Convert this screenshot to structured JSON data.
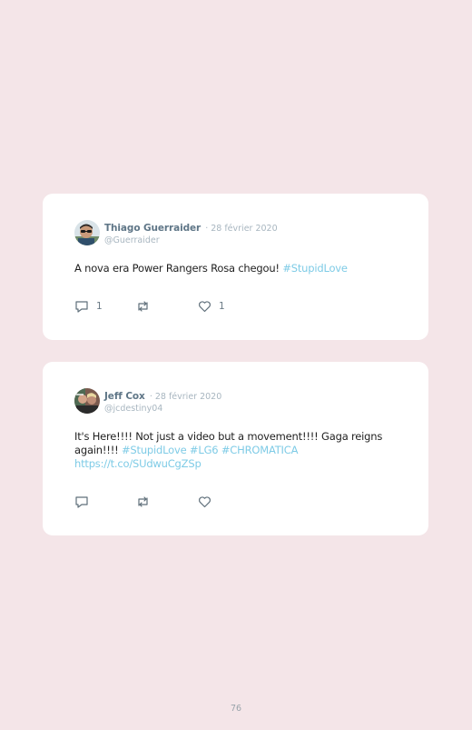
{
  "tweets": [
    {
      "name": "Thiago Guerraider",
      "date": "· 28 février 2020",
      "handle": "@Guerraider",
      "text": "A nova era Power Rangers Rosa chegou!",
      "hashtags": [
        "#StupidLove"
      ],
      "reply_count": "1",
      "retweet_count": "",
      "like_count": "1"
    },
    {
      "name": "Jeff Cox",
      "date": "· 28 février 2020",
      "handle": "@jcdestiny04",
      "text": "It's Here!!!! Not just a video but a movement!!!! Gaga reigns again!!!!",
      "hashtags": [
        "#StupidLove",
        "#LG6",
        "#CHROMATICA"
      ],
      "link": "https://t.co/SUdwuCgZSp",
      "reply_count": "",
      "retweet_count": "",
      "like_count": ""
    }
  ],
  "icons": {
    "reply": "reply-icon",
    "retweet": "retweet-icon",
    "like": "heart-icon"
  },
  "colors": {
    "background": "#f4e5e8",
    "card": "#ffffff",
    "name": "#5f7687",
    "muted": "#a8b6c0",
    "hashtag": "#7ecbe6"
  },
  "page_number": "76"
}
